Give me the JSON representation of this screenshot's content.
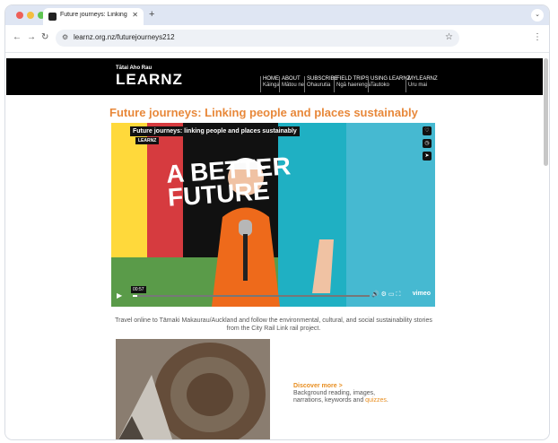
{
  "browser": {
    "tab_title": "Future journeys: Linking pe",
    "url": "learnz.org.nz/futurejourneys212",
    "window_controls": {
      "close": "#ee5f58",
      "minimize": "#f4be41",
      "maximize": "#5fc552"
    },
    "icons": {
      "back": "arrow-left",
      "forward": "arrow-right",
      "reload": "reload",
      "site_info": "tune",
      "bookmark": "star",
      "menu": "kebab",
      "new_tab": "plus",
      "tab_close": "close",
      "tab_search": "chevron-down"
    }
  },
  "site": {
    "logo_small": "Tātai Aho Rau",
    "logo": "LEARNZ",
    "nav": [
      {
        "label": "HOME",
        "sub": "Kāinga"
      },
      {
        "label": "ABOUT",
        "sub": "Mātou nei"
      },
      {
        "label": "SUBSCRIBE",
        "sub": "Ohaurutia"
      },
      {
        "label": "FIELD TRIPS",
        "sub": "Ngā haerenga"
      },
      {
        "label": "USING LEARNZ",
        "sub": "Tautoko"
      },
      {
        "label": "MYLEARNZ",
        "sub": "Uru mai"
      }
    ]
  },
  "page": {
    "title": "Future journeys: Linking people and places sustainably",
    "video": {
      "title": "Future journeys: linking people and places sustainably",
      "brand": "LEARNZ",
      "overlay_text_line1": "A BETTER",
      "overlay_text_line2": "FUTURE",
      "time": "00:57",
      "progress": 0.02,
      "provider": "vimeo"
    },
    "description": "Travel online to Tāmaki Makaurau/Auckland and follow the environmental, cultural, and social sustainability stories from the City Rail Link rail project.",
    "discover": {
      "heading": "Discover more >",
      "text_before": "Background reading, images, narrations, keywords and ",
      "quiz_link": "quizzes",
      "text_after": "."
    }
  },
  "colors": {
    "accent": "#e88d1e",
    "header_bg": "#000000",
    "title": "#e8883a"
  }
}
